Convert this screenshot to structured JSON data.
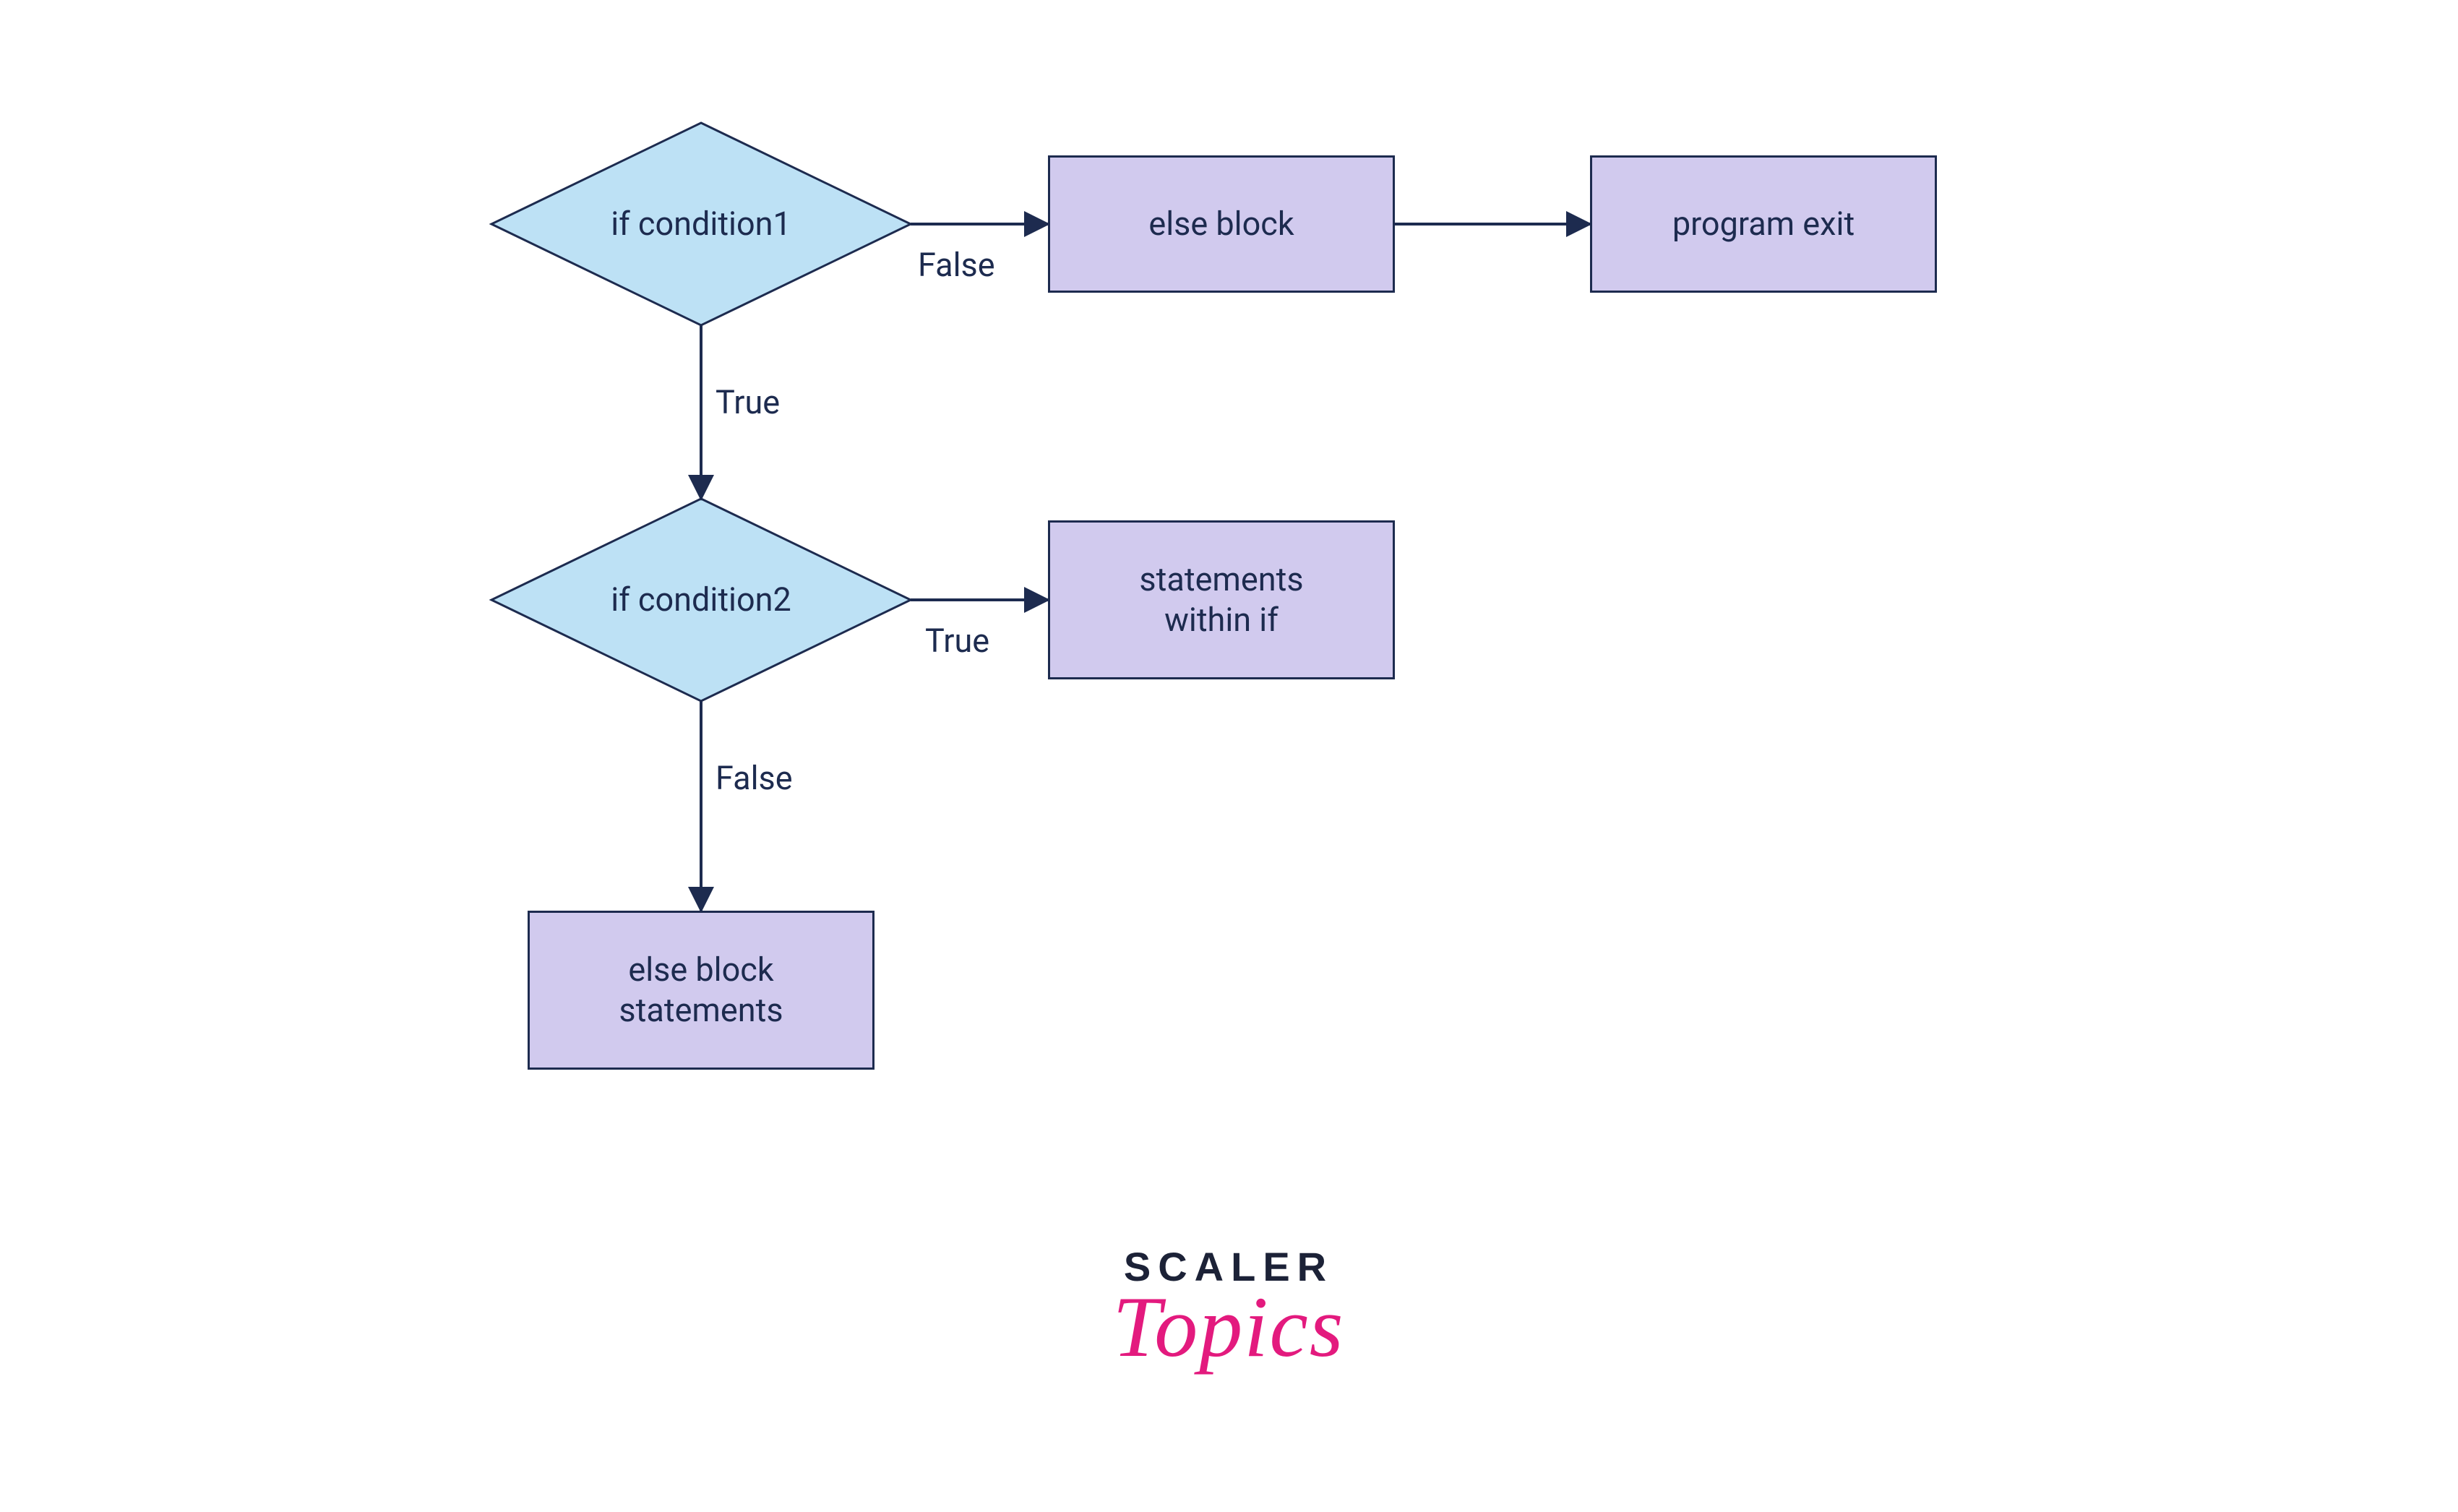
{
  "colors": {
    "stroke": "#1d2b4f",
    "diamond_fill": "#bde1f5",
    "rect_fill": "#d1caee",
    "logo_dark": "#1c2237",
    "logo_pink": "#e31a7e"
  },
  "nodes": {
    "cond1": {
      "label": "if condition1"
    },
    "cond2": {
      "label": "if condition2"
    },
    "else_block": {
      "label": "else block"
    },
    "program_exit": {
      "label": "program exit"
    },
    "stmts_within_if": {
      "label": "statements\nwithin if"
    },
    "else_block_stmts": {
      "label": "else block\nstatements"
    }
  },
  "edges": {
    "cond1_false": "False",
    "cond1_true": "True",
    "cond2_true": "True",
    "cond2_false": "False"
  },
  "logo": {
    "line1": "SCALER",
    "line2": "Topics"
  }
}
